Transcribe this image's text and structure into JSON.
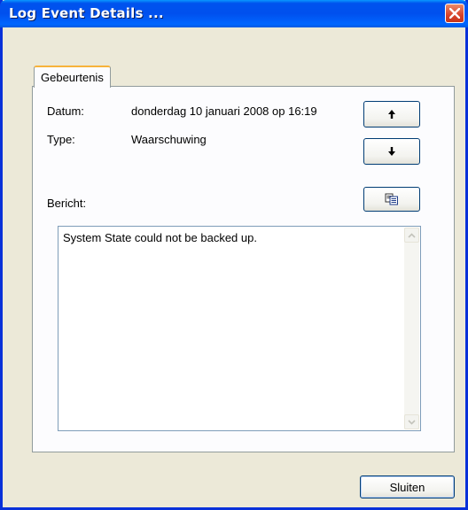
{
  "window": {
    "title": "Log Event Details ...",
    "close_icon": "close-icon"
  },
  "tabs": [
    {
      "label": "Gebeurtenis",
      "active": true
    }
  ],
  "fields": {
    "date_label": "Datum:",
    "date_value": "donderdag 10 januari 2008 op 16:19",
    "type_label": "Type:",
    "type_value": "Waarschuwing",
    "message_label": "Bericht:",
    "message_text": "System State could not be backed up."
  },
  "buttons": {
    "up_icon": "arrow-up-icon",
    "down_icon": "arrow-down-icon",
    "copy_icon": "copy-icon",
    "close_label": "Sluiten"
  },
  "colors": {
    "titlebar": "#0054e3",
    "tab_accent": "#f7b33b",
    "button_border": "#003c74"
  }
}
